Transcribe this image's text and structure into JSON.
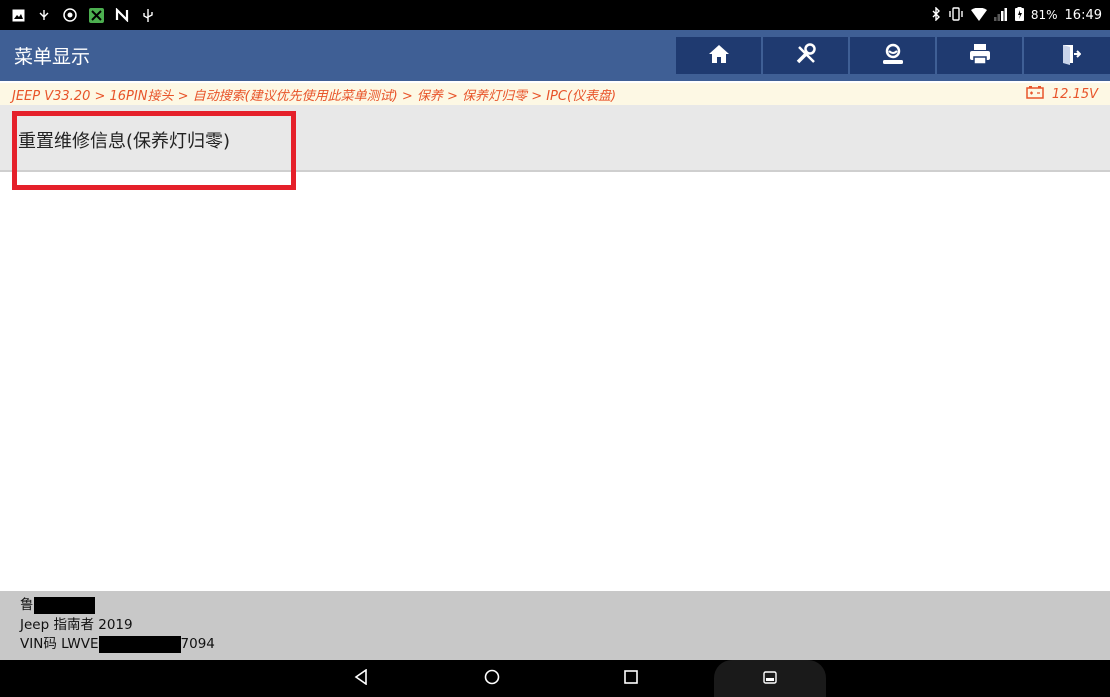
{
  "status_bar": {
    "battery": "81%",
    "time": "16:49",
    "left_icons": [
      "image-icon",
      "usb-debug-icon",
      "settings-icon",
      "app-icon",
      "n-icon",
      "usb-icon"
    ],
    "right_icons": [
      "bluetooth-icon",
      "vibrate-icon",
      "wifi-icon",
      "signal-icon",
      "battery-icon"
    ]
  },
  "header": {
    "title": "菜单显示",
    "toolbar": [
      "home-icon",
      "tools-icon",
      "user-icon",
      "print-icon",
      "exit-icon"
    ]
  },
  "breadcrumb": {
    "path": "JEEP V33.20 > 16PIN接头 > 自动搜索(建议优先使用此菜单测试) > 保养 > 保养灯归零 > IPC(仪表盘)",
    "voltage": "12.15V"
  },
  "menu": {
    "items": [
      {
        "label": "重置维修信息(保养灯归零)"
      }
    ]
  },
  "footer": {
    "plate_prefix": "鲁",
    "vehicle": "Jeep 指南者 2019",
    "vin_prefix": "VIN码 LWVE",
    "vin_suffix": "7094"
  },
  "colors": {
    "header_bg": "#3f5f95",
    "toolbar_btn": "#1f3a70",
    "breadcrumb_text": "#e8542a",
    "highlight": "#e5202a"
  }
}
